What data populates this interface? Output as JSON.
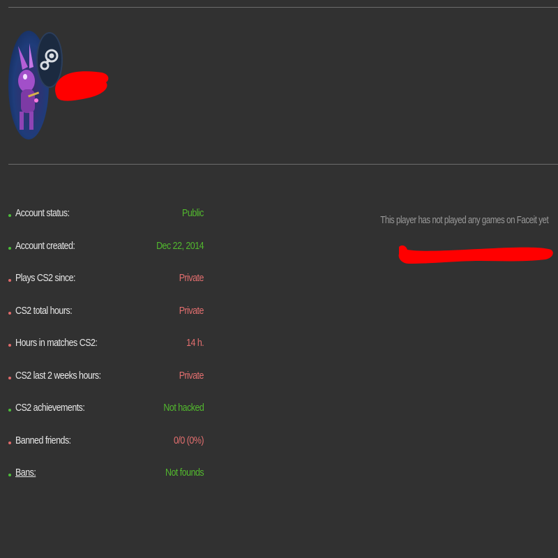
{
  "profile": {
    "avatar_icon": "avatar-image-icon",
    "badge_icon": "steam-icon"
  },
  "stats": [
    {
      "label": "Account status:",
      "value": "Public",
      "status": "good"
    },
    {
      "label": "Account created:",
      "value": "Dec 22, 2014",
      "status": "good"
    },
    {
      "label": "Plays CS2 since:",
      "value": "Private",
      "status": "bad"
    },
    {
      "label": "CS2 total hours:",
      "value": "Private",
      "status": "bad"
    },
    {
      "label": "Hours in matches CS2:",
      "value": "14 h.",
      "status": "bad"
    },
    {
      "label": "CS2 last 2 weeks hours:",
      "value": "Private",
      "status": "bad"
    },
    {
      "label": "CS2 achievements:",
      "value": "Not hacked",
      "status": "good"
    },
    {
      "label": "Banned friends:",
      "value": "0/0 (0%)",
      "status": "bad"
    },
    {
      "label": "Bans:",
      "value": "Not founds",
      "status": "good"
    }
  ],
  "faceit": {
    "message": "This player has not played any games on Faceit yet"
  },
  "colors": {
    "background": "#313131",
    "good": "#52b82e",
    "bad": "#e36f6f",
    "redaction": "#ff0000"
  }
}
